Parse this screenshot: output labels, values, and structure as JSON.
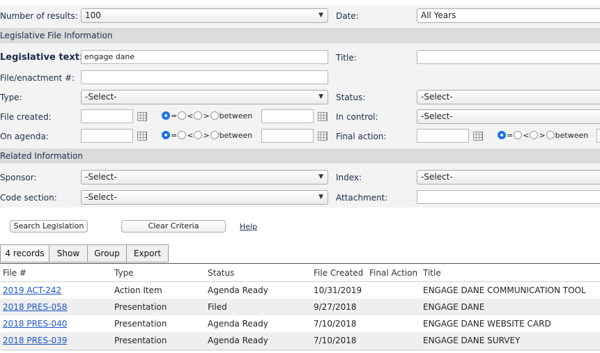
{
  "search": {
    "num_results_label": "Number of results:",
    "num_results_value": "100",
    "date_label": "Date:",
    "date_value": "All Years",
    "section_legislative": "Legislative File Information",
    "leg_text_label": "Legislative text:",
    "leg_text_value": "engage dane",
    "title_label": "Title:",
    "title_value": "",
    "file_enact_label": "File/enactment #:",
    "file_enact_value": "",
    "type_label": "Type:",
    "type_value": "-Select-",
    "status_label": "Status:",
    "status_value": "-Select-",
    "file_created_label": "File created:",
    "in_control_label": "In control:",
    "in_control_value": "-Select-",
    "on_agenda_label": "On agenda:",
    "final_action_label": "Final action:",
    "radio_eq": "=",
    "radio_lt": "<",
    "radio_gt": ">",
    "radio_between": "between",
    "section_related": "Related Information",
    "sponsor_label": "Sponsor:",
    "sponsor_value": "-Select-",
    "index_label": "Index:",
    "index_value": "-Select-",
    "code_section_label": "Code section:",
    "code_section_value": "-Select-",
    "attachment_label": "Attachment:",
    "attachment_value": ""
  },
  "actions": {
    "search_button": "Search Legislation",
    "clear_button": "Clear Criteria",
    "help_link": "Help"
  },
  "results": {
    "tabs": [
      "4 records",
      "Show",
      "Group",
      "Export"
    ],
    "columns": [
      "File #",
      "Type",
      "Status",
      "File Created",
      "Final Action",
      "Title"
    ],
    "rows": [
      {
        "file": "2019 ACT-242",
        "type": "Action Item",
        "status": "Agenda Ready",
        "created": "10/31/2019",
        "final": "",
        "title": "ENGAGE DANE COMMUNICATION TOOL"
      },
      {
        "file": "2018 PRES-058",
        "type": "Presentation",
        "status": "Filed",
        "created": "9/27/2018",
        "final": "",
        "title": "ENGAGE DANE"
      },
      {
        "file": "2018 PRES-040",
        "type": "Presentation",
        "status": "Agenda Ready",
        "created": "7/10/2018",
        "final": "",
        "title": "ENGAGE DANE WEBSITE CARD"
      },
      {
        "file": "2018 PRES-039",
        "type": "Presentation",
        "status": "Agenda Ready",
        "created": "7/10/2018",
        "final": "",
        "title": "ENGAGE DANE SURVEY"
      }
    ]
  },
  "icons": {
    "calendar": "calendar-icon",
    "dropdown": "chevron-down-icon",
    "radio_selected_color": "#1a73e8"
  }
}
